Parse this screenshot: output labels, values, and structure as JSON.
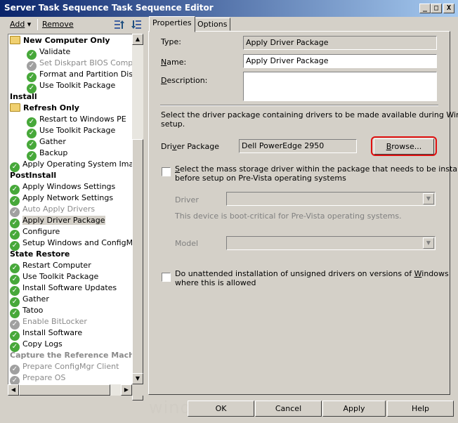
{
  "window": {
    "title": "Server Task Sequence Task Sequence Editor",
    "minimize_glyph": "_",
    "maximize_glyph": "□",
    "close_glyph": "X"
  },
  "toolbar": {
    "add_label": "Add",
    "add_arrow": "▾",
    "remove_label": "Remove",
    "move_up_icon": "move-up-icon",
    "move_down_icon": "move-down-icon"
  },
  "tree": [
    {
      "label": "New Computer Only",
      "type": "group-folder",
      "depth": 0
    },
    {
      "label": "Validate",
      "type": "step",
      "depth": 1
    },
    {
      "label": "Set Diskpart BIOS Compatibi",
      "type": "step-disabled",
      "depth": 1
    },
    {
      "label": "Format and Partition Disk",
      "type": "step",
      "depth": 1
    },
    {
      "label": "Use Toolkit Package",
      "type": "step",
      "depth": 1
    },
    {
      "label": "Install",
      "type": "group",
      "depth": 0
    },
    {
      "label": "Refresh Only",
      "type": "group-folder",
      "depth": 0
    },
    {
      "label": "Restart to Windows PE",
      "type": "step",
      "depth": 1
    },
    {
      "label": "Use Toolkit Package",
      "type": "step",
      "depth": 1
    },
    {
      "label": "Gather",
      "type": "step",
      "depth": 1
    },
    {
      "label": "Backup",
      "type": "step",
      "depth": 1
    },
    {
      "label": "Apply Operating System Image",
      "type": "step",
      "depth": 0
    },
    {
      "label": "PostInstall",
      "type": "group",
      "depth": 0
    },
    {
      "label": "Apply Windows Settings",
      "type": "step",
      "depth": 0
    },
    {
      "label": "Apply Network Settings",
      "type": "step",
      "depth": 0
    },
    {
      "label": "Auto Apply Drivers",
      "type": "step-disabled",
      "depth": 0
    },
    {
      "label": "Apply Driver Package",
      "type": "step-selected",
      "depth": 0
    },
    {
      "label": "Configure",
      "type": "step",
      "depth": 0
    },
    {
      "label": "Setup Windows and ConfigMgr",
      "type": "step",
      "depth": 0
    },
    {
      "label": "State Restore",
      "type": "group",
      "depth": 0
    },
    {
      "label": "Restart Computer",
      "type": "step",
      "depth": 0
    },
    {
      "label": "Use Toolkit Package",
      "type": "step",
      "depth": 0
    },
    {
      "label": "Install Software Updates",
      "type": "step",
      "depth": 0
    },
    {
      "label": "Gather",
      "type": "step",
      "depth": 0
    },
    {
      "label": "Tatoo",
      "type": "step",
      "depth": 0
    },
    {
      "label": "Enable BitLocker",
      "type": "step-disabled",
      "depth": 0
    },
    {
      "label": "Install Software",
      "type": "step",
      "depth": 0
    },
    {
      "label": "Copy Logs",
      "type": "step",
      "depth": 0
    },
    {
      "label": "Capture the Reference Machin",
      "type": "group-disabled",
      "depth": 0
    },
    {
      "label": "Prepare ConfigMgr Client",
      "type": "step-disabled",
      "depth": 0
    },
    {
      "label": "Prepare OS",
      "type": "step-disabled",
      "depth": 0
    }
  ],
  "tabs": [
    {
      "label": "Properties",
      "active": true
    },
    {
      "label": "Options",
      "active": false
    }
  ],
  "properties": {
    "type_label": "Type:",
    "type_value": "Apply Driver Package",
    "name_label_prefix": "",
    "name_label_u": "N",
    "name_label_rest": "ame:",
    "name_value": "Apply Driver Package",
    "desc_label_u": "D",
    "desc_label_rest": "escription:",
    "desc_value": "",
    "instructions_line1": "Select the driver package containing drivers to be made available during Windows",
    "instructions_line2": "setup.",
    "driver_package_label_pre": "Dri",
    "driver_package_label_u": "v",
    "driver_package_label_rest": "er Package",
    "driver_package_value": "Dell PowerEdge 2950",
    "browse_label_u": "B",
    "browse_label_rest": "rowse...",
    "mass_storage_line1_u": "S",
    "mass_storage_line1_rest": "elect the mass storage driver within the package that needs to be installed",
    "mass_storage_line2": "before setup on Pre-Vista operating systems",
    "mass_storage_checked": false,
    "driver_label": "Driver",
    "driver_value": "",
    "boot_critical_note": "This device is boot-critical for Pre-Vista operating systems.",
    "model_label": "Model",
    "model_value": "",
    "unattended_line1_pre": "Do unattended installation of unsigned drivers on versions of ",
    "unattended_line1_u": "W",
    "unattended_line1_rest": "indows",
    "unattended_line2": "where this is allowed",
    "unattended_checked": false
  },
  "buttons": {
    "ok": "OK",
    "cancel": "Cancel",
    "apply": "Apply",
    "help": "Help"
  },
  "watermark": "windows-noob.com",
  "colors": {
    "titlebar_start": "#0a246a",
    "titlebar_end": "#a6caf0",
    "highlight_ring": "#e01010",
    "step_ok": "#47a83a"
  }
}
